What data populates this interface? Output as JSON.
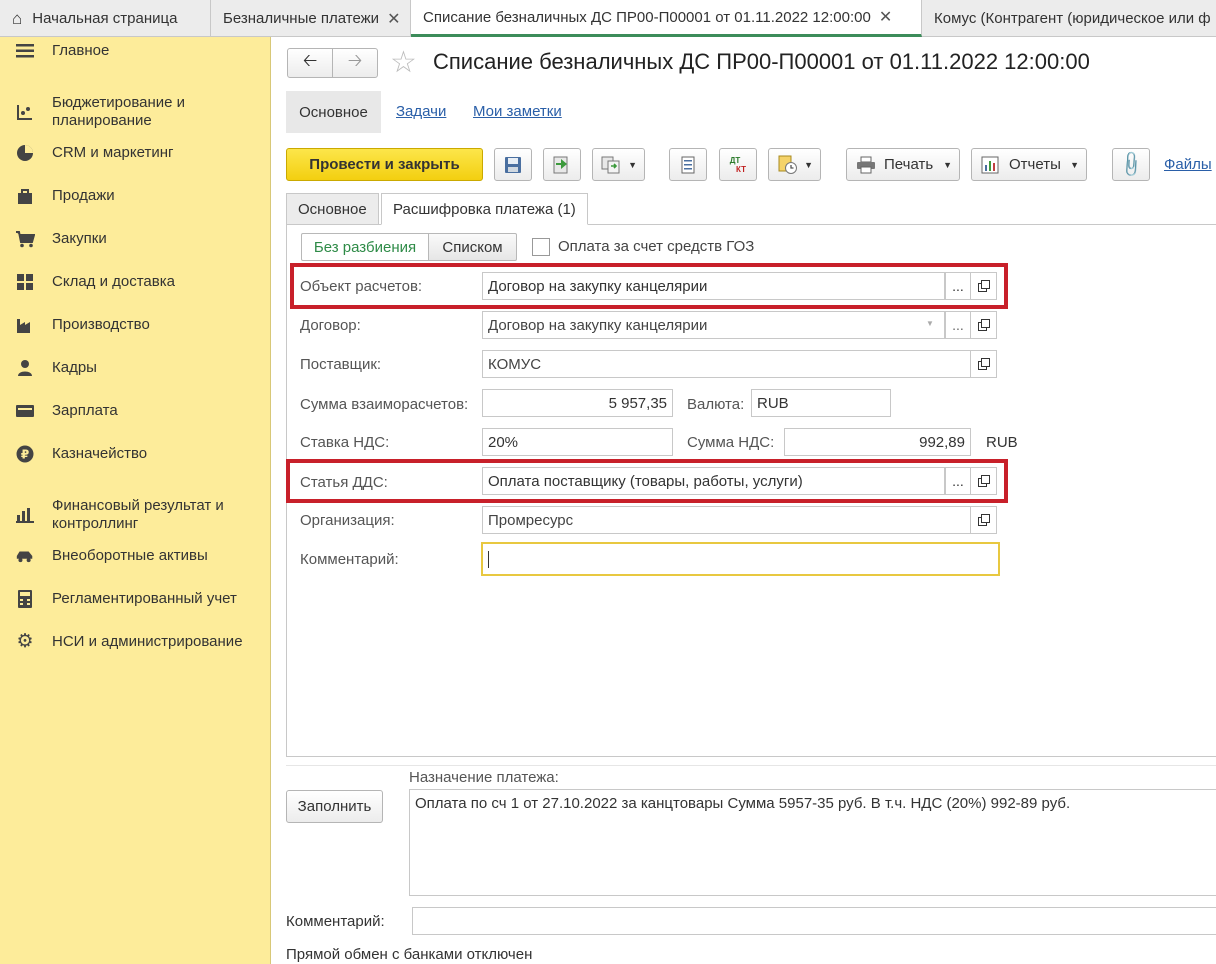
{
  "tabs": {
    "home": "Начальная страница",
    "tab1": "Безналичные платежи",
    "tab2": "Списание безналичных ДС ПР00-П00001 от 01.11.2022 12:00:00",
    "tab3": "Комус (Контрагент (юридическое или ф"
  },
  "sidebar": {
    "items": [
      {
        "label": "Главное",
        "icon": "menu-icon"
      },
      {
        "label": "Бюджетирование и планирование",
        "icon": "budget-icon"
      },
      {
        "label": "CRM и маркетинг",
        "icon": "pie-icon"
      },
      {
        "label": "Продажи",
        "icon": "bag-icon"
      },
      {
        "label": "Закупки",
        "icon": "cart-icon"
      },
      {
        "label": "Склад и доставка",
        "icon": "warehouse-icon"
      },
      {
        "label": "Производство",
        "icon": "factory-icon"
      },
      {
        "label": "Кадры",
        "icon": "person-icon"
      },
      {
        "label": "Зарплата",
        "icon": "wallet-icon"
      },
      {
        "label": "Казначейство",
        "icon": "ruble-icon"
      },
      {
        "label": "Финансовый результат и контроллинг",
        "icon": "bar-chart-icon"
      },
      {
        "label": "Внеоборотные активы",
        "icon": "car-icon"
      },
      {
        "label": "Регламентированный учет",
        "icon": "calculator-icon"
      },
      {
        "label": "НСИ и администрирование",
        "icon": "gear-icon"
      }
    ]
  },
  "doc": {
    "title": "Списание безналичных ДС ПР00-П00001 от 01.11.2022 12:00:00",
    "nav_main": "Основное",
    "nav_tasks": "Задачи",
    "nav_notes": "Мои заметки"
  },
  "toolbar": {
    "post_close": "Провести и закрыть",
    "print": "Печать",
    "reports": "Отчеты",
    "files": "Файлы",
    "dt_kt_top": "ДТ",
    "dt_kt_bottom": "КТ"
  },
  "subtabs": {
    "main": "Основное",
    "decode": "Расшифровка платежа (1)",
    "no_split": "Без разбиения",
    "list": "Списком",
    "goz": "Оплата за счет средств ГОЗ"
  },
  "form": {
    "obj_label": "Объект расчетов:",
    "obj_value": "Договор на закупку канцелярии",
    "contract_label": "Договор:",
    "contract_value": "Договор на закупку канцелярии",
    "supplier_label": "Поставщик:",
    "supplier_value": "КОМУС",
    "sum_label": "Сумма взаиморасчетов:",
    "sum_value": "5 957,35",
    "currency_label": "Валюта:",
    "currency_value": "RUB",
    "vat_rate_label": "Ставка НДС:",
    "vat_rate_value": "20%",
    "vat_sum_label": "Сумма НДС:",
    "vat_sum_value": "992,89",
    "vat_currency": "RUB",
    "dds_label": "Статья ДДС:",
    "dds_value": "Оплата поставщику (товары, работы, услуги)",
    "org_label": "Организация:",
    "org_value": "Промресурс",
    "comment_label": "Комментарий:",
    "comment_value": "",
    "ellipsis": "..."
  },
  "bottom": {
    "purpose_label": "Назначение платежа:",
    "fill_button": "Заполнить",
    "purpose_text": "Оплата по сч 1 от 27.10.2022 за канцтовары Сумма 5957-35 руб. В т.ч. НДС (20%) 992-89 руб.",
    "comment_label": "Комментарий:",
    "comment_value": "",
    "bank_status": "Прямой обмен с банками отключен"
  },
  "colors": {
    "sidebar_bg": "#fdec9a",
    "primary_button": "#f3cf10",
    "highlight_box": "#c8202a",
    "active_tab_accent": "#3c8c5a",
    "link": "#2a5fa8",
    "focus_border": "#e8c840"
  }
}
